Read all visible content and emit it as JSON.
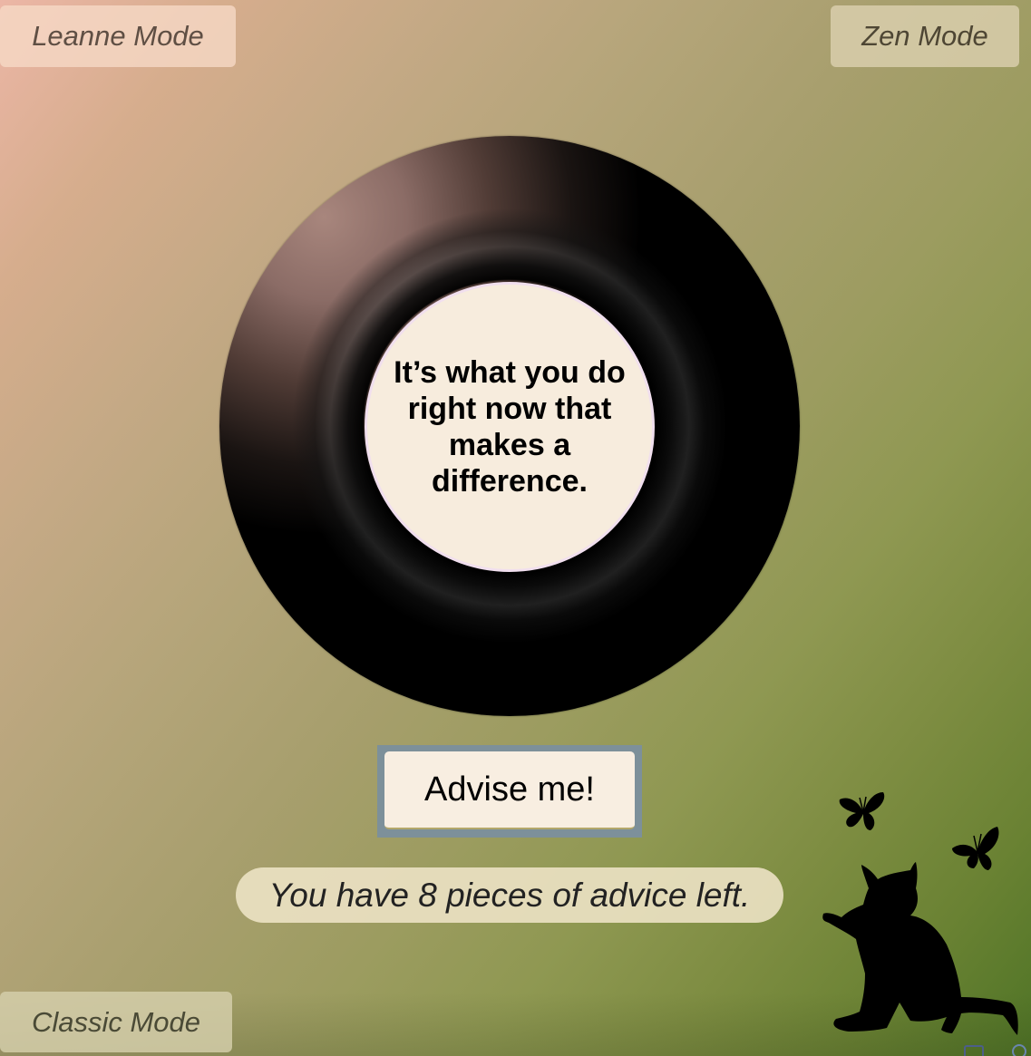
{
  "modes": {
    "leanne_label": "Leanne Mode",
    "zen_label": "Zen Mode",
    "classic_label": "Classic Mode"
  },
  "ball": {
    "answer": "It’s what you do right now that makes a difference."
  },
  "advise_button": {
    "label": "Advise me!"
  },
  "counter": {
    "text": "You have 8 pieces of advice left."
  },
  "decorations": {
    "icons": [
      "cat-silhouette-icon",
      "butterfly-icon",
      "butterfly-icon"
    ]
  },
  "colors": {
    "ball": "#000000",
    "answer_window": "#f7ecdd",
    "advise_button_frame": "#7d909a",
    "background_top_left": "#ecb6a6",
    "background_bottom_right": "#4f7426"
  }
}
